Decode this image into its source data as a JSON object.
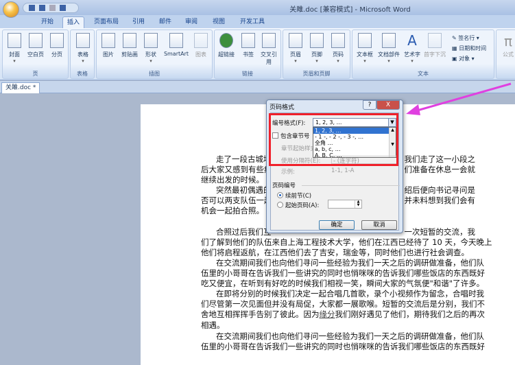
{
  "window": {
    "title": "关雎.doc [兼容模式] - Microsoft Word"
  },
  "tabs": [
    "开始",
    "插入",
    "页面布局",
    "引用",
    "邮件",
    "审阅",
    "视图",
    "开发工具"
  ],
  "ribbon": {
    "groups": [
      {
        "label": "页",
        "buttons": [
          "封面",
          "空白页",
          "分页"
        ]
      },
      {
        "label": "表格",
        "buttons": [
          "表格"
        ]
      },
      {
        "label": "插图",
        "buttons": [
          "图片",
          "剪贴画",
          "形状",
          "SmartArt",
          "图表"
        ]
      },
      {
        "label": "链接",
        "buttons": [
          "超链接",
          "书签",
          "交叉引用"
        ]
      },
      {
        "label": "页眉和页脚",
        "buttons": [
          "页眉",
          "页脚",
          "页码"
        ]
      },
      {
        "label": "文本",
        "buttons": [
          "文本框",
          "文档部件",
          "艺术字",
          "首字下沉"
        ],
        "small": [
          "签名行",
          "日期和时间",
          "对象"
        ]
      },
      {
        "label": "",
        "buttons": [
          "公式"
        ]
      }
    ]
  },
  "doc_tab": "关雎.doc *",
  "document": {
    "lines": [
      {
        "l": "走了一段古城墙",
        "r": "我们走了这一小段之",
        "indent": true
      },
      {
        "l": "后大家又感到有些疲",
        "r": "们准备在休息一会就"
      },
      {
        "l": "继续出发的时候。",
        "r": ""
      },
      {
        "l": "突然最初偶遇的",
        "r": "绍后便向书记寻问是",
        "indent": true
      },
      {
        "l": "否可以两支队伍一起",
        "r": "并未料想到我们会有"
      },
      {
        "l": "机会一起拍合照。",
        "r": ""
      },
      {
        "l": "合照过后我们互",
        "r": "一次短暂的交流，我",
        "indent": true
      },
      {
        "l": "们了解到他们的队伍来自上海工程技术大学，他们在江西已经待了 10 天，今天晚上"
      },
      {
        "l": "他们将启程返航，在江西他们去了吉安，瑞金等，同时他们也进行社会调查。"
      },
      {
        "l": "在交流期间我们也向他们寻问一些经验为我们一天之后的调研做准备，他们队",
        "indent": true
      },
      {
        "l": "伍里的小哥哥在告诉我们一些讲究的同时也悄咪咪的告诉我们哪些饭店的东西既好"
      },
      {
        "l": "吃又便宜，在听到有好吃的时候我们相视一笑，瞬间大家的气氛便\"和谐\"了许多。"
      },
      {
        "l": "在即将分别的时候我们决定一起合唱几首歌，录个小视频作为留念，合唱时我",
        "indent": true
      },
      {
        "l": "们尽管第一次见面但并没有局促，大家都一展歌喉。短暂的交流后是分别，我们不"
      },
      {
        "l": "舍地互相挥挥手告别了彼此。因为",
        "link": "缘分",
        "l2": "我们刚好遇见了他们，期待我们之后的再次"
      },
      {
        "l": "相遇。"
      },
      {
        "l": "在交流期间我们也向他们寻问一些经验为我们一天之后的调研做准备，他们队",
        "indent": true
      },
      {
        "l": "伍里的小哥哥在告诉我们一些讲究的同时也悄咪咪的告诉我们哪些饭店的东西既好"
      }
    ]
  },
  "dialog": {
    "title": "页码格式",
    "help": "?",
    "close": "X",
    "format_label": "编号格式(F):",
    "format_value": "1, 2, 3, …",
    "format_options": [
      "1, 2, 3, …",
      "- 1 -, - 2 -, - 3 -, …",
      "全角 …",
      "a, b, c, …",
      "A, B, C, …"
    ],
    "include_chapter": "包含章节号",
    "chapter_start": "章节起始样式",
    "separator_label": "使用分隔符(E):",
    "separator_value": "-  (连字符)",
    "example_label": "示例:",
    "example_value": "1-1, 1-A",
    "numbering_section": "页码编号",
    "continue": "续前节(C)",
    "start_at": "起始页码(A):",
    "ok": "确定",
    "cancel": "取消"
  },
  "colors": {
    "highlight": "#f0202a",
    "arrow": "#e040e0"
  }
}
